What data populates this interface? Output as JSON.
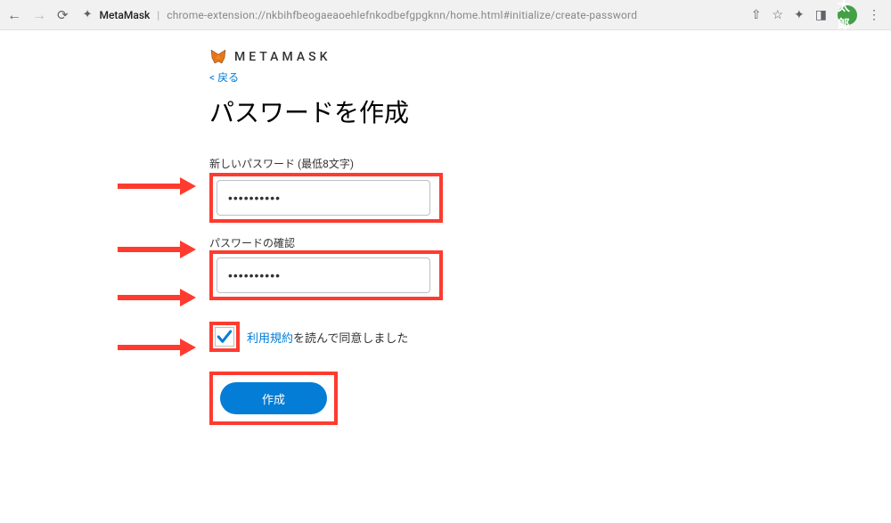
{
  "browser": {
    "site_name": "MetaMask",
    "url": "chrome-extension://nkbihfbeogaeaoehlefnkodbefgpgknn/home.html#initialize/create-password",
    "avatar_label": "太郎"
  },
  "brand": {
    "name": "METAMASK"
  },
  "back_link": "< 戻る",
  "title": "パスワードを作成",
  "fields": {
    "new_password_label": "新しいパスワード (最低8文字)",
    "new_password_value": "••••••••••",
    "confirm_password_label": "パスワードの確認",
    "confirm_password_value": "••••••••••"
  },
  "terms": {
    "link_text": "利用規約",
    "suffix_text": "を読んで同意しました",
    "checked": true
  },
  "button": {
    "create_label": "作成"
  },
  "annotation_color": "#ff3b2f"
}
